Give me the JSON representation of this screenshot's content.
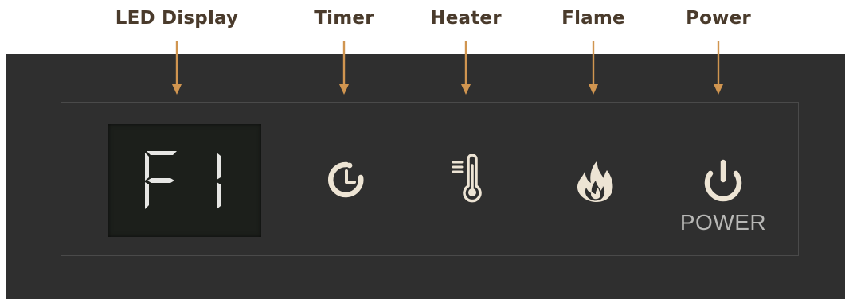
{
  "callouts": {
    "led_display": "LED Display",
    "timer": "Timer",
    "heater": "Heater",
    "flame": "Flame",
    "power": "Power"
  },
  "display": {
    "reading": "F1"
  },
  "buttons": {
    "timer_icon": "clock-icon",
    "heater_icon": "thermometer-icon",
    "flame_icon": "flame-icon",
    "power_icon": "power-icon",
    "power_text": "POWER"
  },
  "colors": {
    "callout_text": "#4a3b2c",
    "arrow": "#d09550",
    "panel": "#2f2f2f",
    "icon": "#ede4d4",
    "lcd_background": "#1c1f1b",
    "lcd_segment": "#e6e6e4",
    "power_text": "#b8b8b6"
  }
}
